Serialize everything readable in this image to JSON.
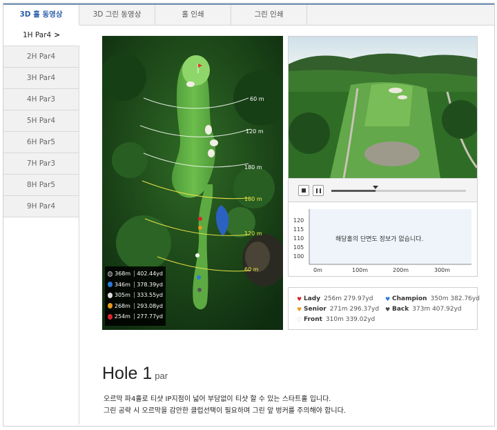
{
  "tabs": [
    {
      "label": "3D 홀 동영상"
    },
    {
      "label": "3D 그린 동영상"
    },
    {
      "label": "홀 인쇄"
    },
    {
      "label": "그린 인쇄"
    }
  ],
  "nav": [
    {
      "label": "1H Par4",
      "chevron": ">"
    },
    {
      "label": "2H Par4"
    },
    {
      "label": "3H Par4"
    },
    {
      "label": "4H Par3"
    },
    {
      "label": "5H Par4"
    },
    {
      "label": "6H Par5"
    },
    {
      "label": "7H Par3"
    },
    {
      "label": "8H Par5"
    },
    {
      "label": "9H Par4"
    }
  ],
  "map": {
    "arc_labels": [
      "60 m",
      "120 m",
      "180 m",
      "180 m",
      "120 m",
      "60 m"
    ],
    "distances": [
      {
        "tee": "B",
        "color": "#4a4a4a",
        "m": "368m",
        "yd": "402.44yd"
      },
      {
        "tee": "C",
        "color": "#2a7bd8",
        "m": "346m",
        "yd": "378.39yd"
      },
      {
        "tee": "F",
        "color": "#dddddd",
        "m": "305m",
        "yd": "333.55yd"
      },
      {
        "tee": "S",
        "color": "#e59a1c",
        "m": "268m",
        "yd": "293.08yd"
      },
      {
        "tee": "L",
        "color": "#d9262b",
        "m": "254m",
        "yd": "277.77yd"
      }
    ]
  },
  "elevation": {
    "message": "해당홀의 단면도 정보가 없습니다.",
    "y_ticks": [
      "120",
      "115",
      "110",
      "105",
      "100"
    ],
    "x_ticks": [
      "0m",
      "100m",
      "200m",
      "300m"
    ]
  },
  "legend": [
    {
      "name": "Lady",
      "value": "256m 279.97yd",
      "color": "#d9262b"
    },
    {
      "name": "Champion",
      "value": "350m 382.76yd",
      "color": "#2a7bd8"
    },
    {
      "name": "Senior",
      "value": "271m 296.37yd",
      "color": "#e59a1c"
    },
    {
      "name": "Back",
      "value": "373m 407.92yd",
      "color": "#4a4a4a"
    },
    {
      "name": "Front",
      "value": "310m 339.02yd",
      "color": "#aaaaaa"
    }
  ],
  "hole": {
    "title": "Hole 1",
    "par_label": "par",
    "desc_line1": "오르막 파4홀로 티샷 IP지점이 넓어 부담없이 티샷 할 수 있는 스타트홀 입니다.",
    "desc_line2": "그린 공략 시 오르막을 감안한 클럽선택이 필요하며 그린 앞 벙커를 주의해야 합니다."
  }
}
